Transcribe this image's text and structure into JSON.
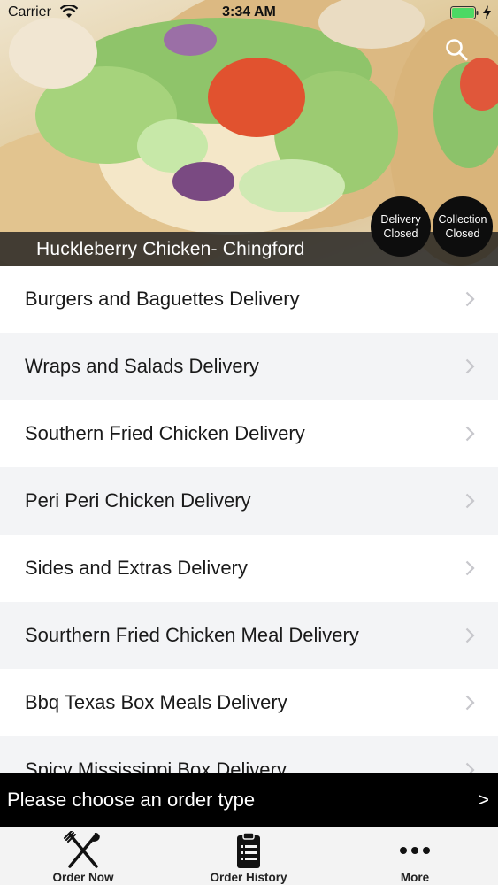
{
  "status_bar": {
    "carrier": "Carrier",
    "time": "3:34 AM",
    "icons": [
      "wifi-icon",
      "battery-icon",
      "bolt-icon"
    ]
  },
  "header": {
    "restaurant_name": "Huckleberry Chicken- Chingford",
    "delivery_status": {
      "line1": "Delivery",
      "line2": "Closed"
    },
    "collection_status": {
      "line1": "Collection",
      "line2": "Closed"
    },
    "search_icon": "search-icon"
  },
  "menu": {
    "items": [
      {
        "label": "Burgers and Baguettes Delivery"
      },
      {
        "label": "Wraps and Salads Delivery"
      },
      {
        "label": "Southern Fried Chicken Delivery"
      },
      {
        "label": "Peri Peri Chicken Delivery"
      },
      {
        "label": "Sides and Extras Delivery"
      },
      {
        "label": "Sourthern Fried Chicken Meal Delivery"
      },
      {
        "label": "Bbq Texas Box Meals Delivery"
      },
      {
        "label": "Spicy Mississippi Box Delivery"
      }
    ]
  },
  "order_type_bar": {
    "text": "Please choose an order type",
    "arrow": ">"
  },
  "tab_bar": {
    "tabs": [
      {
        "label": "Order Now",
        "icon": "fork-knife-icon"
      },
      {
        "label": "Order History",
        "icon": "clipboard-list-icon"
      },
      {
        "label": "More",
        "icon": "more-dots-icon"
      }
    ]
  },
  "colors": {
    "order_bar_bg": "#000000",
    "status_circle_bg": "#0d0d0d",
    "row_alt_bg": "#f3f4f6",
    "battery_green": "#4cd964"
  }
}
